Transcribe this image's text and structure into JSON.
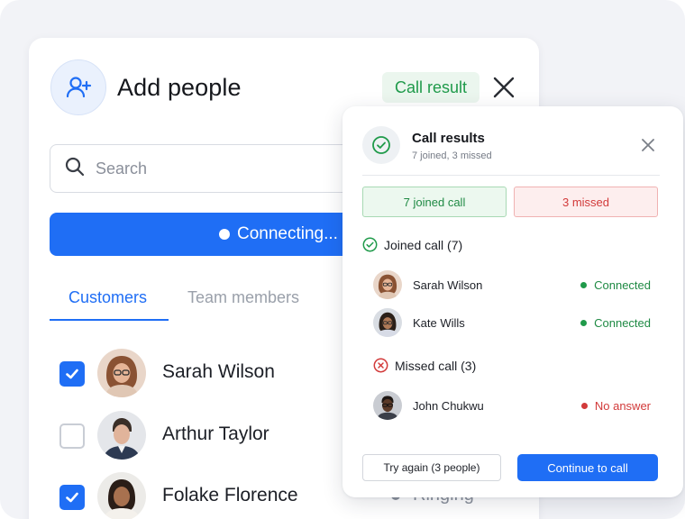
{
  "add_people": {
    "title": "Add people",
    "call_result_chip": "Call result",
    "search": {
      "placeholder": "Search",
      "value": ""
    },
    "connect_button": "Connecting...",
    "tabs": [
      {
        "label": "Customers",
        "active": true
      },
      {
        "label": "Team members",
        "active": false
      }
    ],
    "people": [
      {
        "name": "Sarah Wilson",
        "checked": true
      },
      {
        "name": "Arthur Taylor",
        "checked": false
      },
      {
        "name": "Folake Florence",
        "checked": true,
        "status": "Ringing"
      }
    ]
  },
  "call_results": {
    "title": "Call results",
    "subtitle": "7 joined, 3 missed",
    "joined_stat": "7 joined call",
    "missed_stat": "3 missed",
    "joined_section": {
      "label": "Joined call (7)",
      "contacts": [
        {
          "name": "Sarah Wilson",
          "status": "Connected"
        },
        {
          "name": "Kate Wills",
          "status": "Connected"
        }
      ]
    },
    "missed_section": {
      "label": "Missed call (3)",
      "contacts": [
        {
          "name": "John Chukwu",
          "status": "No answer"
        }
      ]
    },
    "try_again_button": "Try again (3 people)",
    "continue_button": "Continue to call"
  },
  "colors": {
    "accent": "#1f6ef5",
    "success": "#1f9a4a",
    "danger": "#d23a3a",
    "background": "#f2f3f7"
  },
  "icons": [
    "add-user-icon",
    "close-icon",
    "search-icon",
    "check-icon",
    "check-circle-icon",
    "x-circle-icon",
    "status-dot-icon"
  ]
}
